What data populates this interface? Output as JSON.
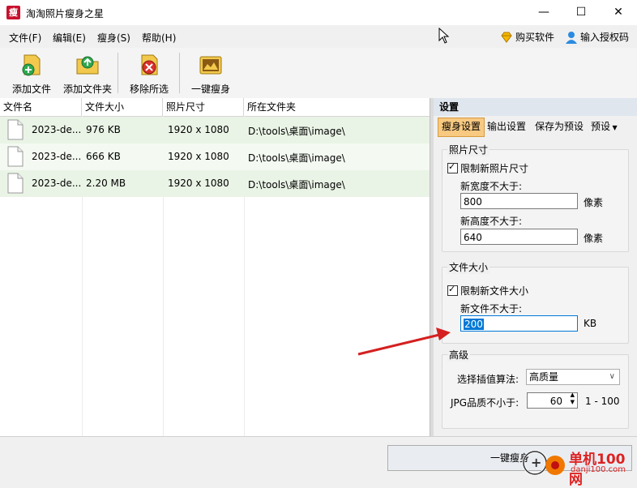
{
  "window": {
    "title": "淘淘照片瘦身之星",
    "icon_char": "瘦"
  },
  "menu": [
    {
      "label": "文件(F)"
    },
    {
      "label": "编辑(E)"
    },
    {
      "label": "瘦身(S)"
    },
    {
      "label": "帮助(H)"
    }
  ],
  "menu_right": {
    "buy": "购买软件",
    "auth": "输入授权码"
  },
  "toolbar": {
    "add_file": "添加文件",
    "add_folder": "添加文件夹",
    "remove_selected": "移除所选",
    "one_click": "一键瘦身"
  },
  "list": {
    "headers": [
      "文件名",
      "文件大小",
      "照片尺寸",
      "所在文件夹"
    ],
    "rows": [
      {
        "name": "2023-de...",
        "size": "976 KB",
        "dims": "1920 x 1080",
        "folder": "D:\\tools\\桌面\\image\\"
      },
      {
        "name": "2023-de...",
        "size": "666 KB",
        "dims": "1920 x 1080",
        "folder": "D:\\tools\\桌面\\image\\"
      },
      {
        "name": "2023-de...",
        "size": "2.20 MB",
        "dims": "1920 x 1080",
        "folder": "D:\\tools\\桌面\\image\\"
      }
    ]
  },
  "settings": {
    "title": "设置",
    "tabs": [
      "瘦身设置",
      "输出设置",
      "保存为预设",
      "预设"
    ],
    "photo_size": {
      "group": "照片尺寸",
      "limit_label": "限制新照片尺寸",
      "width_label": "新宽度不大于:",
      "width_value": "800",
      "height_label": "新高度不大于:",
      "height_value": "640",
      "unit": "像素"
    },
    "file_size": {
      "group": "文件大小",
      "limit_label": "限制新文件大小",
      "max_label": "新文件不大于:",
      "max_value": "200",
      "unit": "KB"
    },
    "advanced": {
      "group": "高级",
      "interp_label": "选择插值算法:",
      "interp_value": "高质量",
      "jpg_label": "JPG品质不小于:",
      "jpg_value": "60",
      "jpg_range": "1 - 100"
    }
  },
  "bottom": {
    "button": "一键瘦身"
  },
  "watermark": {
    "line1": "单机100网",
    "line2": "danji100.com"
  },
  "colors": {
    "active_tab": "#f7c981",
    "row_odd": "#eaf4e6",
    "arrow": "#d42020"
  }
}
